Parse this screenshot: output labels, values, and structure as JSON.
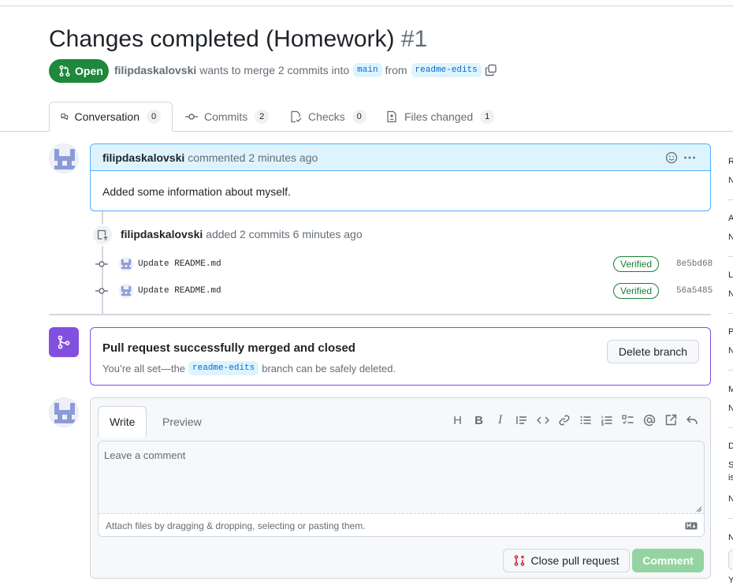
{
  "pr": {
    "title": "Changes completed (Homework)",
    "number": "#1",
    "state": "Open",
    "author": "filipdaskalovski",
    "meta_middle": "wants to merge 2 commits into",
    "base_branch": "main",
    "meta_from": "from",
    "head_branch": "readme-edits"
  },
  "tabs": [
    {
      "label": "Conversation",
      "count": "0",
      "icon": "conversation-icon"
    },
    {
      "label": "Commits",
      "count": "2",
      "icon": "commit-icon"
    },
    {
      "label": "Checks",
      "count": "0",
      "icon": "checklist-icon"
    },
    {
      "label": "Files changed",
      "count": "1",
      "icon": "file-diff-icon"
    }
  ],
  "comment": {
    "author": "filipdaskalovski",
    "action": "commented 2 minutes ago",
    "body": "Added some information about myself."
  },
  "commits_event": {
    "author": "filipdaskalovski",
    "action": "added 2 commits 6 minutes ago",
    "commits": [
      {
        "message": "Update README.md",
        "badge": "Verified",
        "sha": "8e5bd68"
      },
      {
        "message": "Update README.md",
        "badge": "Verified",
        "sha": "56a5485"
      }
    ]
  },
  "merge": {
    "title": "Pull request successfully merged and closed",
    "sub_prefix": "You’re all set—the",
    "branch": "readme-edits",
    "sub_suffix": "branch can be safely deleted.",
    "delete_button": "Delete branch"
  },
  "editor": {
    "tab_write": "Write",
    "tab_preview": "Preview",
    "placeholder": "Leave a comment",
    "attach_hint": "Attach files by dragging & dropping, selecting or pasting them.",
    "toolbar": [
      "H",
      "B",
      "I"
    ],
    "close_button": "Close pull request",
    "comment_button": "Comment"
  },
  "sidebar_letters": [
    "R",
    "N",
    "A",
    "N",
    "L",
    "N",
    "P",
    "N",
    "M",
    "N",
    "D",
    "S",
    "is",
    "N",
    "N",
    "Y"
  ],
  "colors": {
    "open_green": "#1f883d",
    "merged_purple": "#8250df",
    "link_blue": "#0969da",
    "verified_green": "#1a7f37"
  }
}
